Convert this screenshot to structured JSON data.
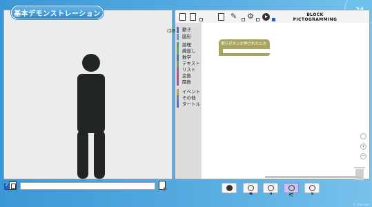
{
  "app": {
    "title": "基本デモンストレーション",
    "corner_badge": "24",
    "coord_readout": "(28",
    "footer_note": "© ©nCoder"
  },
  "editor": {
    "title_line1": "BLOCK",
    "title_line2": "PICTOGRAMMING",
    "categories": [
      {
        "label": "動き",
        "color": "#4a73b8"
      },
      {
        "label": "図形",
        "color": "#6c8fd0"
      },
      {
        "label": "論理",
        "color": "#4f9a8d"
      },
      {
        "label": "繰返し",
        "color": "#5ba86a"
      },
      {
        "label": "数学",
        "color": "#5570b0"
      },
      {
        "label": "テキスト",
        "color": "#6aa06a"
      },
      {
        "label": "リスト",
        "color": "#9a5fa8"
      },
      {
        "label": "変数",
        "color": "#b0517a"
      },
      {
        "label": "関数",
        "color": "#9b57a6"
      },
      {
        "label": "イベント",
        "color": "#a9a55e"
      },
      {
        "label": "その他",
        "color": "#5f7fb0"
      },
      {
        "label": "タートル",
        "color": "#4a73b8"
      }
    ],
    "hat_block_label": "実行ボタンが押されたとき",
    "zoom_in": "+",
    "zoom_out": "−"
  },
  "controls": {
    "buttons": [
      {
        "name": "play",
        "icon": "play-icon"
      },
      {
        "name": "step-back",
        "icon": "rewind-icon"
      },
      {
        "name": "pause",
        "icon": "pause-icon"
      },
      {
        "name": "step-forward",
        "icon": "step-icon"
      },
      {
        "name": "stop",
        "icon": "close-icon"
      }
    ],
    "active": "step-forward"
  },
  "colors": {
    "accent": "#3f9ad6",
    "event_block": "#a9a55e",
    "active_button": "#c8c4ee"
  }
}
